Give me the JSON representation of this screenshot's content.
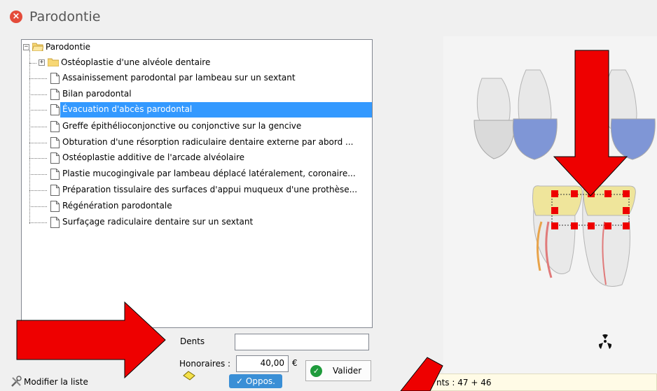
{
  "window": {
    "title": "Parodontie",
    "close_icon": "close-circle-icon"
  },
  "tree": {
    "root": {
      "label": "Parodontie",
      "expander": "−"
    },
    "items": [
      {
        "label": "Ostéoplastie d'une alvéole dentaire",
        "type": "folder",
        "expander": "+"
      },
      {
        "label": "Assainissement parodontal par lambeau sur un sextant",
        "type": "doc"
      },
      {
        "label": "Bilan parodontal",
        "type": "doc"
      },
      {
        "label": "Évacuation d'abcès parodontal",
        "type": "doc",
        "selected": true
      },
      {
        "label": "Greffe épithélioconjonctive ou conjonctive sur la gencive",
        "type": "doc"
      },
      {
        "label": "Obturation d'une résorption radiculaire dentaire externe par abord ...",
        "type": "doc"
      },
      {
        "label": "Ostéoplastie additive de l'arcade alvéolaire",
        "type": "doc"
      },
      {
        "label": "Plastie mucogingivale par lambeau déplacé latéralement, coronaire...",
        "type": "doc"
      },
      {
        "label": "Préparation tissulaire des surfaces d'appui muqueux d'une prothèse...",
        "type": "doc"
      },
      {
        "label": "Régénération parodontale",
        "type": "doc"
      },
      {
        "label": "Surfaçage radiculaire dentaire sur un sextant",
        "type": "doc"
      }
    ]
  },
  "form": {
    "dents_label": "Dents",
    "dents_value": "",
    "honoraires_label": "Honoraires :",
    "honoraires_value": "40,00",
    "currency": "€",
    "valider_label": "Valider",
    "oppos_label": "✓ Oppos.",
    "modifier_label": "Modifier la liste"
  },
  "status": {
    "text": "nts : 47 + 46"
  },
  "colors": {
    "selection": "#3399ff",
    "arrow": "#ee0000",
    "tooth_blue": "#7f96d6",
    "tooth_yellow": "#efe59b",
    "valider_check": "#1f9b3c",
    "oppos_bg": "#3a8fd6"
  }
}
